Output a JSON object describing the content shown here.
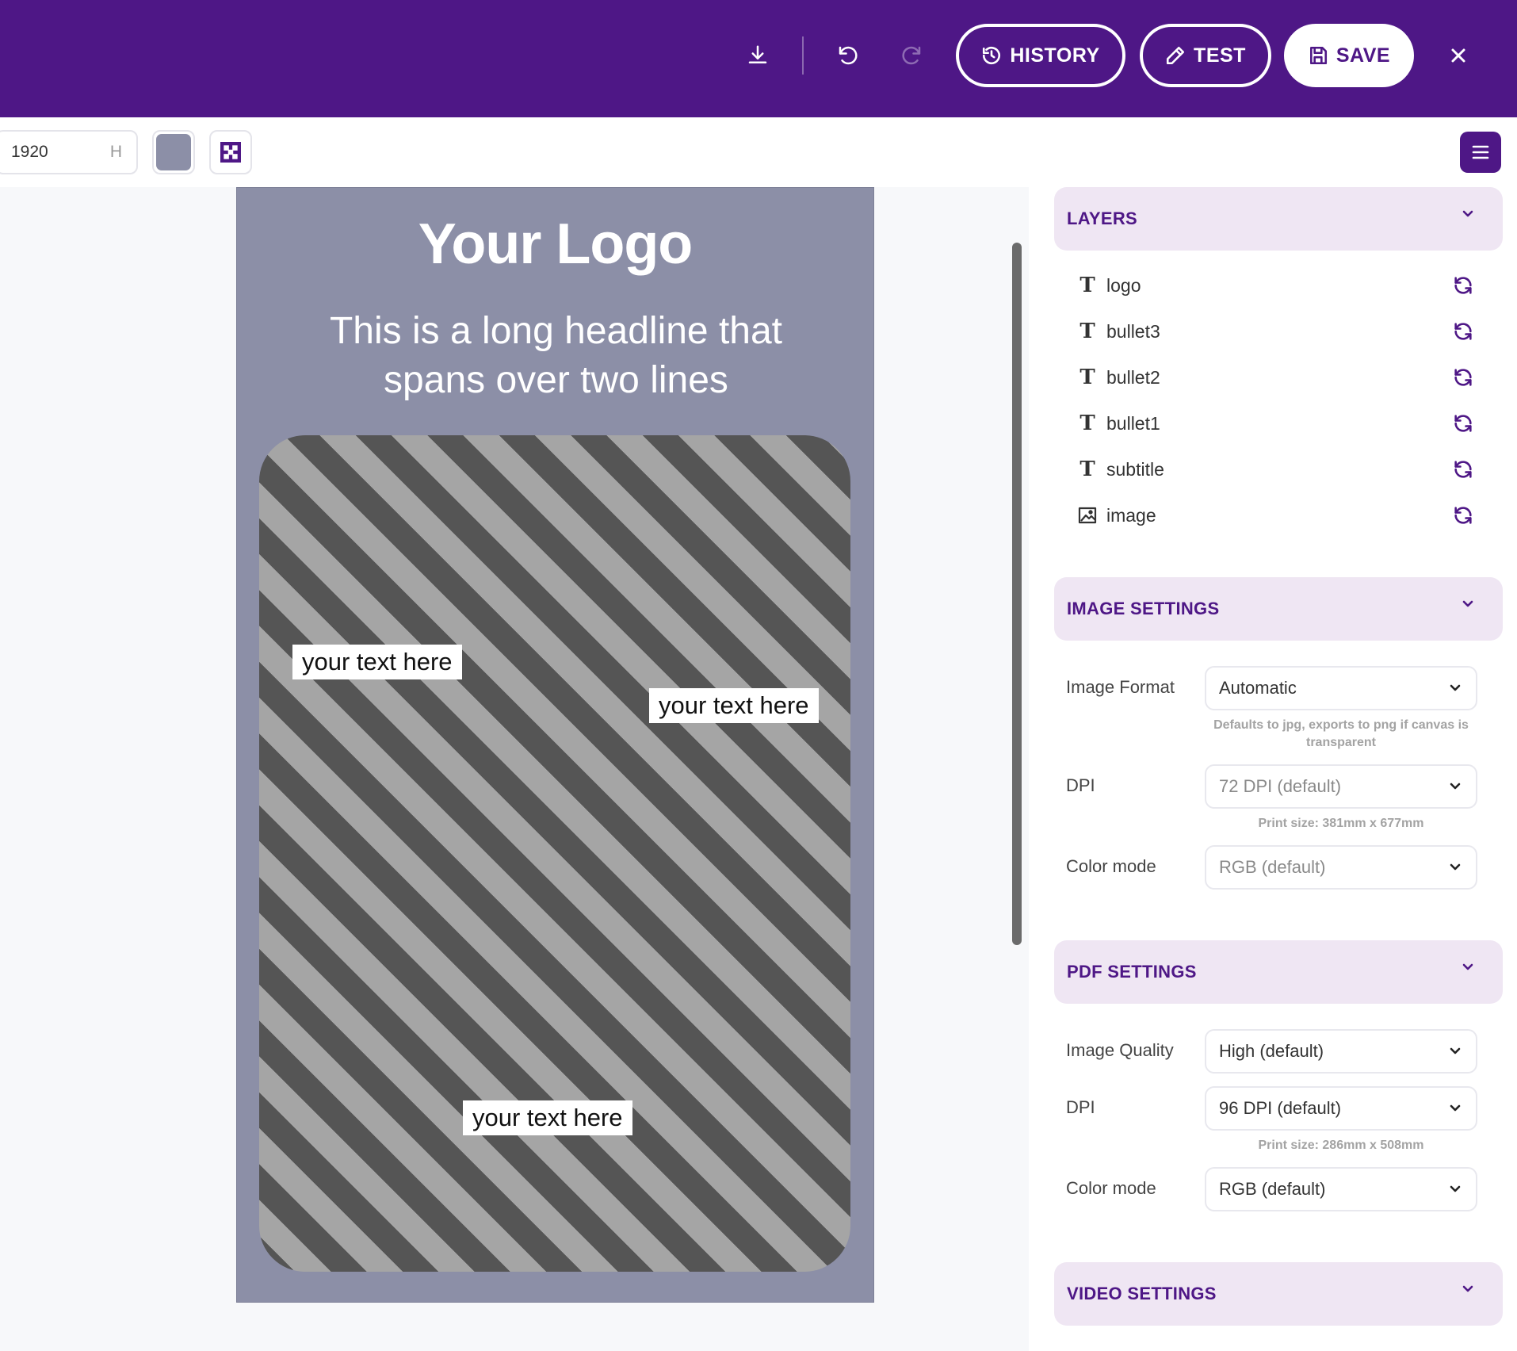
{
  "header": {
    "history_label": "HISTORY",
    "test_label": "TEST",
    "save_label": "SAVE"
  },
  "toolbar": {
    "width_value": "1920",
    "height_unit": "H",
    "bg_color": "#8c8fa7"
  },
  "canvas": {
    "logo": "Your Logo",
    "headline": "This is a long headline that spans over two lines",
    "bullets": [
      "your text here",
      "your text here",
      "your text here"
    ]
  },
  "panel": {
    "layers": {
      "title": "LAYERS",
      "items": [
        {
          "name": "logo",
          "type": "text"
        },
        {
          "name": "bullet3",
          "type": "text"
        },
        {
          "name": "bullet2",
          "type": "text"
        },
        {
          "name": "bullet1",
          "type": "text"
        },
        {
          "name": "subtitle",
          "type": "text"
        },
        {
          "name": "image",
          "type": "image"
        }
      ]
    },
    "image_settings": {
      "title": "IMAGE SETTINGS",
      "format_label": "Image Format",
      "format_value": "Automatic",
      "format_hint": "Defaults to jpg, exports to png if canvas is transparent",
      "dpi_label": "DPI",
      "dpi_value": "72 DPI (default)",
      "dpi_hint": "Print size: 381mm x 677mm",
      "color_label": "Color mode",
      "color_value": "RGB (default)"
    },
    "pdf_settings": {
      "title": "PDF SETTINGS",
      "quality_label": "Image Quality",
      "quality_value": "High (default)",
      "dpi_label": "DPI",
      "dpi_value": "96 DPI (default)",
      "dpi_hint": "Print size: 286mm x 508mm",
      "color_label": "Color mode",
      "color_value": "RGB (default)"
    },
    "video_settings": {
      "title": "VIDEO SETTINGS"
    }
  },
  "colors": {
    "brand": "#4e1786",
    "panel_header_bg": "#efe6f3",
    "canvas_bg": "#8c8fa7"
  }
}
